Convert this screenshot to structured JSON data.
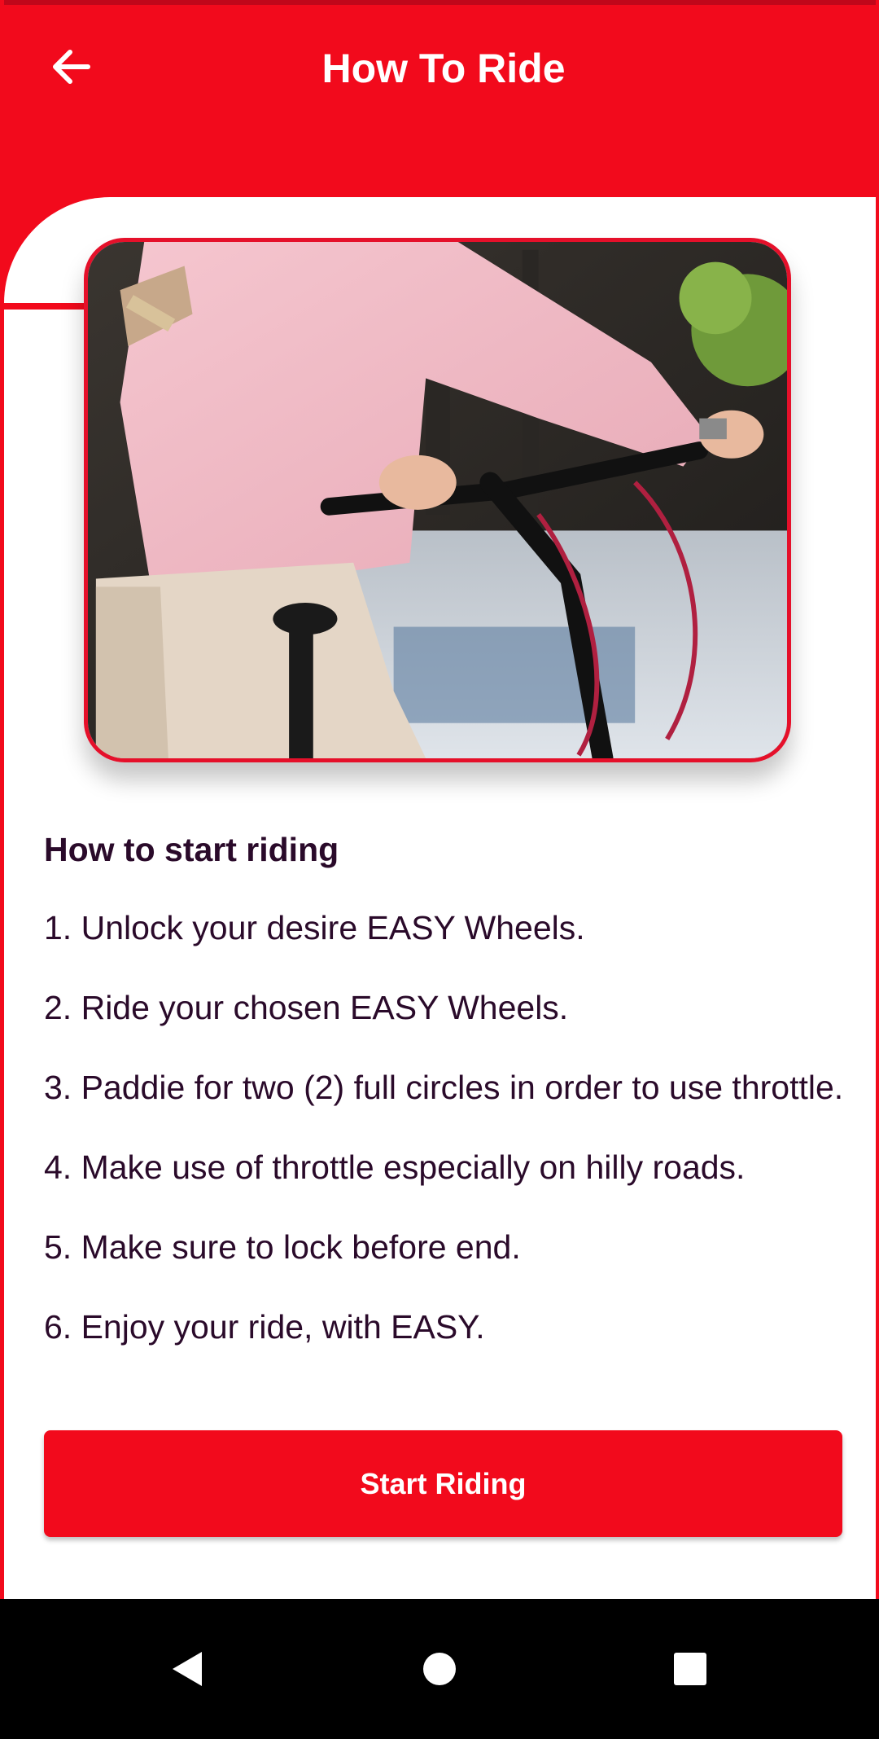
{
  "header": {
    "title": "How To Ride",
    "back_icon": "arrow-left-icon"
  },
  "hero_image": {
    "description_icon": "person-with-bicycle-photo"
  },
  "content": {
    "section_title": "How to start riding",
    "steps": [
      "1. Unlock your desire EASY Wheels.",
      "2. Ride your chosen EASY Wheels.",
      "3. Paddie for two (2) full circles in order to use throttle.",
      "4. Make use of throttle especially on hilly roads.",
      "5. Make sure to lock before end.",
      "6. Enjoy your ride, with EASY."
    ]
  },
  "actions": {
    "start_label": "Start Riding"
  },
  "navbar": {
    "back_icon": "nav-back-icon",
    "home_icon": "nav-home-icon",
    "recents_icon": "nav-recents-icon"
  },
  "colors": {
    "brand_red": "#f20a1c",
    "text_dark": "#2a0a2a"
  }
}
